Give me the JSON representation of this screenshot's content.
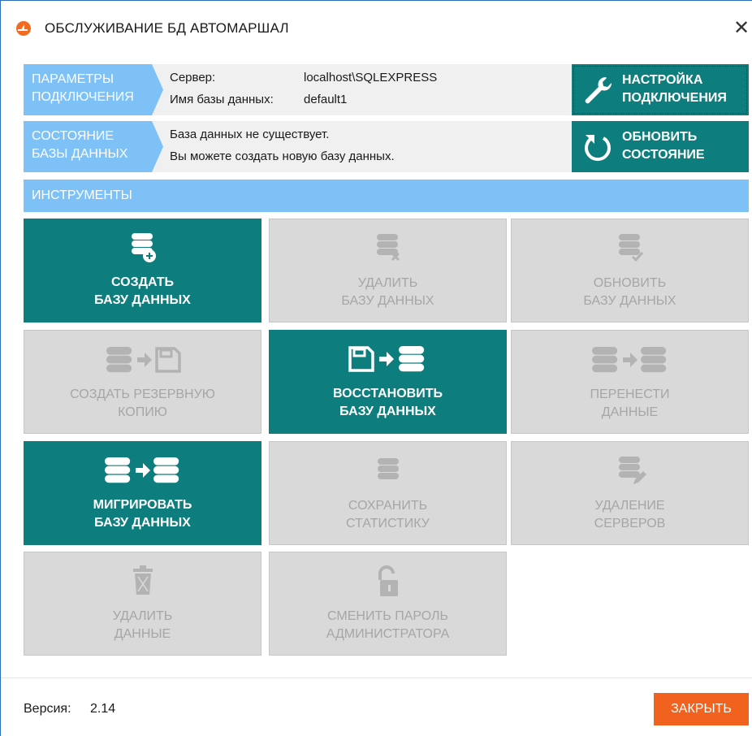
{
  "window": {
    "title": "ОБСЛУЖИВАНИЕ БД АВТОМАРШАЛ",
    "close_glyph": "✕"
  },
  "connection": {
    "label_line1": "ПАРАМЕТРЫ",
    "label_line2": "ПОДКЛЮЧЕНИЯ",
    "server_label": "Сервер:",
    "server_value": "localhost\\SQLEXPRESS",
    "db_label": "Имя базы данных:",
    "db_value": "default1",
    "settings_button_line1": "НАСТРОЙКА",
    "settings_button_line2": "ПОДКЛЮЧЕНИЯ",
    "settings_icon": "wrench-icon"
  },
  "db_state": {
    "label_line1": "СОСТОЯНИЕ",
    "label_line2": "БАЗЫ ДАННЫХ",
    "status_line1": "База данных не существует.",
    "status_line2": "Вы можете создать новую базу данных.",
    "refresh_button_line1": "ОБНОВИТЬ",
    "refresh_button_line2": "СОСТОЯНИЕ",
    "refresh_icon": "refresh-icon"
  },
  "tools": {
    "header": "ИНСТРУМЕНТЫ",
    "items": [
      {
        "line1": "СОЗДАТЬ",
        "line2": "БАЗУ ДАННЫХ",
        "enabled": true,
        "icon": "database-add-icon"
      },
      {
        "line1": "УДАЛИТЬ",
        "line2": "БАЗУ ДАННЫХ",
        "enabled": false,
        "icon": "database-delete-icon"
      },
      {
        "line1": "ОБНОВИТЬ",
        "line2": "БАЗУ ДАННЫХ",
        "enabled": false,
        "icon": "database-check-icon"
      },
      {
        "line1": "СОЗДАТЬ РЕЗЕРВНУЮ",
        "line2": "КОПИЮ",
        "enabled": false,
        "icon": "database-to-floppy-icon"
      },
      {
        "line1": "ВОССТАНОВИТЬ",
        "line2": "БАЗУ ДАННЫХ",
        "enabled": true,
        "icon": "floppy-to-database-icon"
      },
      {
        "line1": "ПЕРЕНЕСТИ",
        "line2": "ДАННЫЕ",
        "enabled": false,
        "icon": "database-to-database-icon"
      },
      {
        "line1": "МИГРИРОВАТЬ",
        "line2": "БАЗУ ДАННЫХ",
        "enabled": true,
        "icon": "database-migrate-icon"
      },
      {
        "line1": "СОХРАНИТЬ",
        "line2": "СТАТИСТИКУ",
        "enabled": false,
        "icon": "database-icon"
      },
      {
        "line1": "УДАЛЕНИЕ",
        "line2": "СЕРВЕРОВ",
        "enabled": false,
        "icon": "database-edit-icon"
      },
      {
        "line1": "УДАЛИТЬ",
        "line2": "ДАННЫЕ",
        "enabled": false,
        "icon": "trash-icon"
      },
      {
        "line1": "СМЕНИТЬ ПАРОЛЬ",
        "line2": "АДМИНИСТРАТОРА",
        "enabled": false,
        "icon": "unlock-icon"
      }
    ]
  },
  "footer": {
    "version_label": "Версия:",
    "version_value": "2.14",
    "close_button": "ЗАКРЫТЬ"
  },
  "colors": {
    "teal": "#0e7d7d",
    "light_blue": "#7ec1f7",
    "disabled": "#d9d9d9",
    "orange": "#f0621d"
  }
}
